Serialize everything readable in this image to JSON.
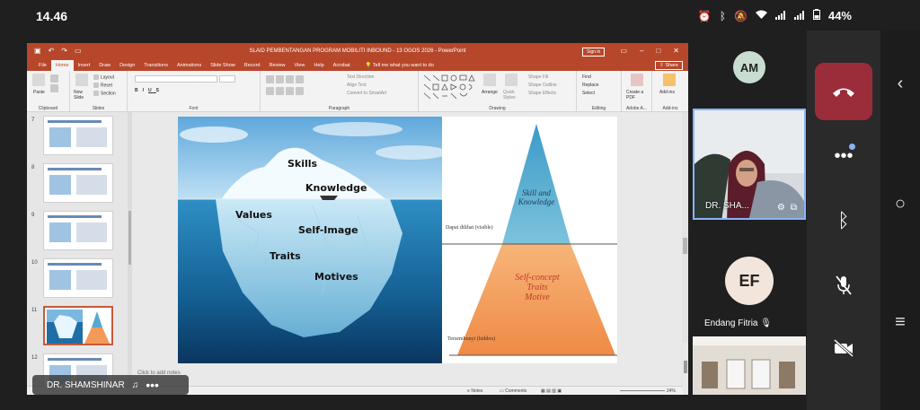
{
  "status_bar": {
    "time": "14.46",
    "battery": "44%"
  },
  "ppt": {
    "window_title": "SLAID PEMBENTANGAN PROGRAM MOBILITI INBOUND - 13 OGOS 2026 - PowerPoint",
    "sign_in": "Sign in",
    "menu_tabs": [
      "File",
      "Home",
      "Insert",
      "Draw",
      "Design",
      "Transitions",
      "Animations",
      "Slide Show",
      "Record",
      "Review",
      "View",
      "Help",
      "Acrobat"
    ],
    "active_tab": "Home",
    "tell_me": "Tell me what you want to do",
    "share": "Share",
    "ribbon": {
      "paste": "Paste",
      "new_slide": "New Slide",
      "layout": "Layout",
      "reset": "Reset",
      "section": "Section",
      "text_direction": "Text Direction",
      "align_text": "Align Text",
      "convert_smartart": "Convert to SmartArt",
      "arrange": "Arrange",
      "quick_styles": "Quick Styles",
      "shape_fill": "Shape Fill",
      "shape_outline": "Shape Outline",
      "shape_effects": "Shape Effects",
      "find": "Find",
      "replace": "Replace",
      "select": "Select",
      "create_pdf": "Create a PDF",
      "addins": "Add-ins",
      "groups": {
        "clipboard": "Clipboard",
        "slides": "Slides",
        "font": "Font",
        "paragraph": "Paragraph",
        "drawing": "Drawing",
        "editing": "Editing",
        "adobe": "Adobe A...",
        "addins": "Add-ins"
      }
    },
    "thumbnails": [
      {
        "num": "7"
      },
      {
        "num": "8"
      },
      {
        "num": "9"
      },
      {
        "num": "10"
      },
      {
        "num": "11"
      },
      {
        "num": "12"
      }
    ],
    "slide": {
      "iceberg_labels": {
        "skills": "Skills",
        "knowledge": "Knowledge",
        "values": "Values",
        "self_image": "Self-Image",
        "traits": "Traits",
        "motives": "Motives"
      },
      "pyramid": {
        "top_line1": "Skill and",
        "top_line2": "Knowledge",
        "bottom_line1": "Self-concept",
        "bottom_line2": "Traits",
        "bottom_line3": "Motive",
        "visible_label": "Dapat dilihat (visible)",
        "hidden_label": "Tersembunyi (hidden)"
      }
    },
    "notes_placeholder": "Click to add notes",
    "status": {
      "notes": "Notes",
      "comments": "Comments",
      "zoom": "24%"
    }
  },
  "presenter_name": "DR. SHAMSHINAR",
  "participants": {
    "am_initials": "AM",
    "video_name": "DR. SHA...",
    "ef_initials": "EF",
    "ef_name": "Endang Fitria"
  },
  "colors": {
    "hangup": "#9b2c3a",
    "ppt_accent": "#b7472a",
    "active_tile_border": "#8ab4f8"
  }
}
